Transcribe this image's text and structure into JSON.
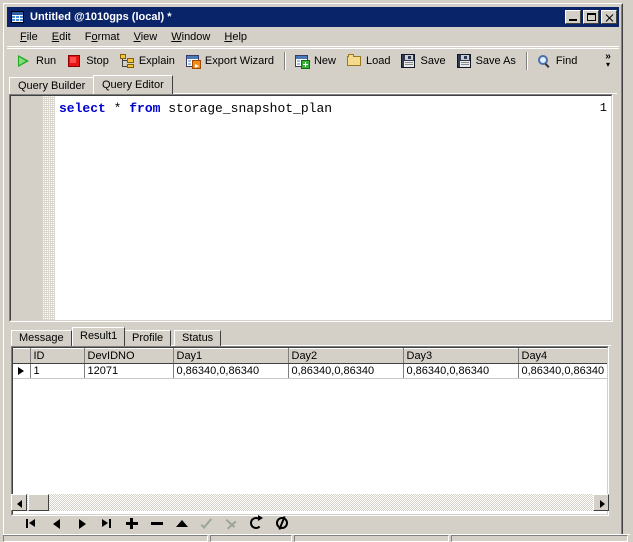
{
  "window": {
    "title": "Untitled @1010gps (local) *",
    "icon": "grid-window-icon",
    "controls": {
      "minimize": "Minimize",
      "maximize": "Maximize",
      "close": "Close"
    }
  },
  "menubar": {
    "items": [
      {
        "label": "File",
        "accel": "F"
      },
      {
        "label": "Edit",
        "accel": "E"
      },
      {
        "label": "Format",
        "accel": "o"
      },
      {
        "label": "View",
        "accel": "V"
      },
      {
        "label": "Window",
        "accel": "W"
      },
      {
        "label": "Help",
        "accel": "H"
      }
    ]
  },
  "toolbar": {
    "run_label": "Run",
    "stop_label": "Stop",
    "explain_label": "Explain",
    "export_wizard_label": "Export Wizard",
    "new_label": "New",
    "load_label": "Load",
    "save_label": "Save",
    "save_as_label": "Save As",
    "find_label": "Find",
    "overflow_label": "»",
    "overflow_caret": "▾"
  },
  "page_tabs": {
    "items": [
      {
        "label": "Query Builder",
        "active": false
      },
      {
        "label": "Query Editor",
        "active": true
      }
    ]
  },
  "editor": {
    "line_number": "1",
    "sql_keyword_1": "select",
    "sql_star": " * ",
    "sql_keyword_2": "from",
    "sql_table": " storage_snapshot_plan",
    "full_text": "select * from storage_snapshot_plan"
  },
  "result_tabs": {
    "items": [
      {
        "label": "Message",
        "active": false
      },
      {
        "label": "Result1",
        "active": true
      },
      {
        "label": "Profile",
        "active": false
      },
      {
        "label": "Status",
        "active": false
      }
    ]
  },
  "grid": {
    "columns": [
      "ID",
      "DevIDNO",
      "Day1",
      "Day2",
      "Day3",
      "Day4"
    ],
    "rows": [
      {
        "indicator": "▶",
        "ID": "1",
        "DevIDNO": "12071",
        "Day1": "0,86340,0,86340",
        "Day2": "0,86340,0,86340",
        "Day3": "0,86340,0,86340",
        "Day4": "0,86340,0,86340"
      }
    ]
  },
  "scrollbar": {
    "left_arrow": "◀",
    "right_arrow": "▶"
  },
  "navigator": {
    "buttons": [
      {
        "name": "first",
        "label": "First record",
        "enabled": true
      },
      {
        "name": "prior",
        "label": "Prior record",
        "enabled": true
      },
      {
        "name": "next",
        "label": "Next record",
        "enabled": true
      },
      {
        "name": "last",
        "label": "Last record",
        "enabled": true
      },
      {
        "name": "insert",
        "label": "Insert record",
        "enabled": true
      },
      {
        "name": "delete",
        "label": "Delete record",
        "enabled": true
      },
      {
        "name": "edit",
        "label": "Edit record",
        "enabled": true
      },
      {
        "name": "post",
        "label": "Post edit",
        "enabled": false
      },
      {
        "name": "cancel",
        "label": "Cancel edit",
        "enabled": false
      },
      {
        "name": "refresh",
        "label": "Refresh data",
        "enabled": true
      },
      {
        "name": "abort",
        "label": "Abort",
        "enabled": true
      }
    ]
  },
  "statusbar": {
    "panels": [
      "",
      "",
      "",
      ""
    ]
  },
  "colors": {
    "title_bar": "#0a246a",
    "face": "#d4d0c8",
    "keyword": "#0000cd",
    "run_green": "#22aa22",
    "stop_red": "#e81414"
  }
}
